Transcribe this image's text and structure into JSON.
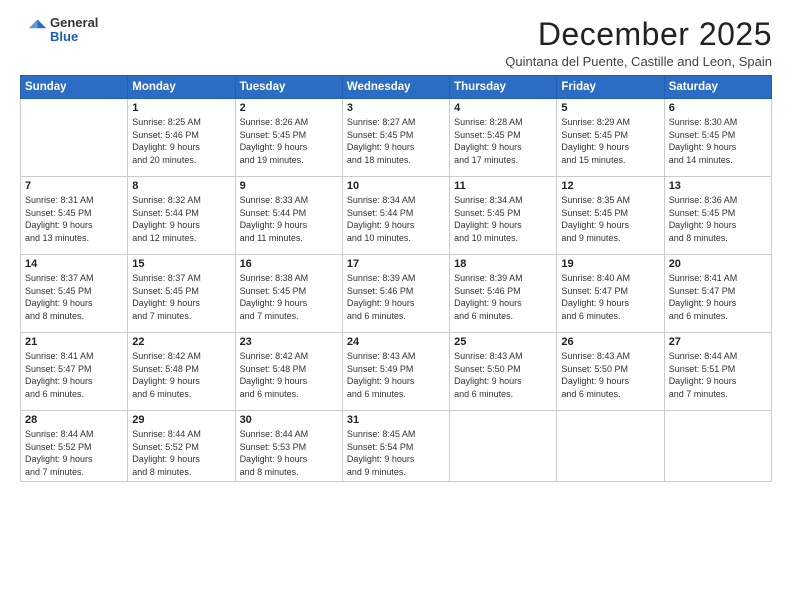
{
  "logo": {
    "general": "General",
    "blue": "Blue"
  },
  "title": "December 2025",
  "location": "Quintana del Puente, Castille and Leon, Spain",
  "days_header": [
    "Sunday",
    "Monday",
    "Tuesday",
    "Wednesday",
    "Thursday",
    "Friday",
    "Saturday"
  ],
  "weeks": [
    [
      {
        "day": "",
        "content": ""
      },
      {
        "day": "1",
        "content": "Sunrise: 8:25 AM\nSunset: 5:46 PM\nDaylight: 9 hours\nand 20 minutes."
      },
      {
        "day": "2",
        "content": "Sunrise: 8:26 AM\nSunset: 5:45 PM\nDaylight: 9 hours\nand 19 minutes."
      },
      {
        "day": "3",
        "content": "Sunrise: 8:27 AM\nSunset: 5:45 PM\nDaylight: 9 hours\nand 18 minutes."
      },
      {
        "day": "4",
        "content": "Sunrise: 8:28 AM\nSunset: 5:45 PM\nDaylight: 9 hours\nand 17 minutes."
      },
      {
        "day": "5",
        "content": "Sunrise: 8:29 AM\nSunset: 5:45 PM\nDaylight: 9 hours\nand 15 minutes."
      },
      {
        "day": "6",
        "content": "Sunrise: 8:30 AM\nSunset: 5:45 PM\nDaylight: 9 hours\nand 14 minutes."
      }
    ],
    [
      {
        "day": "7",
        "content": "Sunrise: 8:31 AM\nSunset: 5:45 PM\nDaylight: 9 hours\nand 13 minutes."
      },
      {
        "day": "8",
        "content": "Sunrise: 8:32 AM\nSunset: 5:44 PM\nDaylight: 9 hours\nand 12 minutes."
      },
      {
        "day": "9",
        "content": "Sunrise: 8:33 AM\nSunset: 5:44 PM\nDaylight: 9 hours\nand 11 minutes."
      },
      {
        "day": "10",
        "content": "Sunrise: 8:34 AM\nSunset: 5:44 PM\nDaylight: 9 hours\nand 10 minutes."
      },
      {
        "day": "11",
        "content": "Sunrise: 8:34 AM\nSunset: 5:45 PM\nDaylight: 9 hours\nand 10 minutes."
      },
      {
        "day": "12",
        "content": "Sunrise: 8:35 AM\nSunset: 5:45 PM\nDaylight: 9 hours\nand 9 minutes."
      },
      {
        "day": "13",
        "content": "Sunrise: 8:36 AM\nSunset: 5:45 PM\nDaylight: 9 hours\nand 8 minutes."
      }
    ],
    [
      {
        "day": "14",
        "content": "Sunrise: 8:37 AM\nSunset: 5:45 PM\nDaylight: 9 hours\nand 8 minutes."
      },
      {
        "day": "15",
        "content": "Sunrise: 8:37 AM\nSunset: 5:45 PM\nDaylight: 9 hours\nand 7 minutes."
      },
      {
        "day": "16",
        "content": "Sunrise: 8:38 AM\nSunset: 5:45 PM\nDaylight: 9 hours\nand 7 minutes."
      },
      {
        "day": "17",
        "content": "Sunrise: 8:39 AM\nSunset: 5:46 PM\nDaylight: 9 hours\nand 6 minutes."
      },
      {
        "day": "18",
        "content": "Sunrise: 8:39 AM\nSunset: 5:46 PM\nDaylight: 9 hours\nand 6 minutes."
      },
      {
        "day": "19",
        "content": "Sunrise: 8:40 AM\nSunset: 5:47 PM\nDaylight: 9 hours\nand 6 minutes."
      },
      {
        "day": "20",
        "content": "Sunrise: 8:41 AM\nSunset: 5:47 PM\nDaylight: 9 hours\nand 6 minutes."
      }
    ],
    [
      {
        "day": "21",
        "content": "Sunrise: 8:41 AM\nSunset: 5:47 PM\nDaylight: 9 hours\nand 6 minutes."
      },
      {
        "day": "22",
        "content": "Sunrise: 8:42 AM\nSunset: 5:48 PM\nDaylight: 9 hours\nand 6 minutes."
      },
      {
        "day": "23",
        "content": "Sunrise: 8:42 AM\nSunset: 5:48 PM\nDaylight: 9 hours\nand 6 minutes."
      },
      {
        "day": "24",
        "content": "Sunrise: 8:43 AM\nSunset: 5:49 PM\nDaylight: 9 hours\nand 6 minutes."
      },
      {
        "day": "25",
        "content": "Sunrise: 8:43 AM\nSunset: 5:50 PM\nDaylight: 9 hours\nand 6 minutes."
      },
      {
        "day": "26",
        "content": "Sunrise: 8:43 AM\nSunset: 5:50 PM\nDaylight: 9 hours\nand 6 minutes."
      },
      {
        "day": "27",
        "content": "Sunrise: 8:44 AM\nSunset: 5:51 PM\nDaylight: 9 hours\nand 7 minutes."
      }
    ],
    [
      {
        "day": "28",
        "content": "Sunrise: 8:44 AM\nSunset: 5:52 PM\nDaylight: 9 hours\nand 7 minutes."
      },
      {
        "day": "29",
        "content": "Sunrise: 8:44 AM\nSunset: 5:52 PM\nDaylight: 9 hours\nand 8 minutes."
      },
      {
        "day": "30",
        "content": "Sunrise: 8:44 AM\nSunset: 5:53 PM\nDaylight: 9 hours\nand 8 minutes."
      },
      {
        "day": "31",
        "content": "Sunrise: 8:45 AM\nSunset: 5:54 PM\nDaylight: 9 hours\nand 9 minutes."
      },
      {
        "day": "",
        "content": ""
      },
      {
        "day": "",
        "content": ""
      },
      {
        "day": "",
        "content": ""
      }
    ]
  ]
}
